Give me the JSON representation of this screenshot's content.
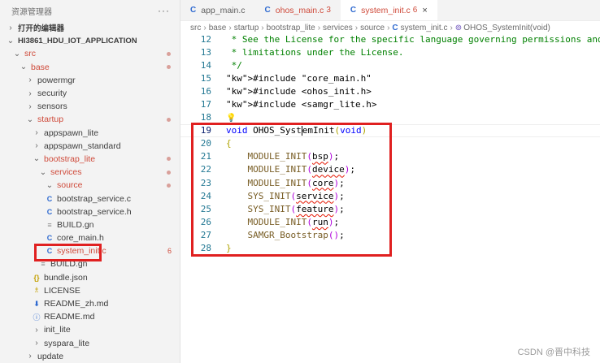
{
  "explorer": {
    "title": "资源管理器",
    "more_icon": "···",
    "items": [
      {
        "label": "打开的编辑器",
        "indent": 0,
        "arrow": "›",
        "style": "bold"
      },
      {
        "label": "HI3861_HDU_IOT_APPLICATION",
        "indent": 0,
        "arrow": "⌄",
        "style": "bold"
      },
      {
        "label": "src",
        "indent": 1,
        "arrow": "⌄",
        "style": "red",
        "dot": true
      },
      {
        "label": "base",
        "indent": 2,
        "arrow": "⌄",
        "style": "red",
        "dot": true
      },
      {
        "label": "powermgr",
        "indent": 3,
        "arrow": "›"
      },
      {
        "label": "security",
        "indent": 3,
        "arrow": "›"
      },
      {
        "label": "sensors",
        "indent": 3,
        "arrow": "›"
      },
      {
        "label": "startup",
        "indent": 3,
        "arrow": "⌄",
        "style": "red",
        "dot": true
      },
      {
        "label": "appspawn_lite",
        "indent": 4,
        "arrow": "›"
      },
      {
        "label": "appspawn_standard",
        "indent": 4,
        "arrow": "›"
      },
      {
        "label": "bootstrap_lite",
        "indent": 4,
        "arrow": "⌄",
        "style": "red",
        "dot": true
      },
      {
        "label": "services",
        "indent": 5,
        "arrow": "⌄",
        "style": "red",
        "dot": true
      },
      {
        "label": "source",
        "indent": 6,
        "arrow": "⌄",
        "style": "red",
        "dot": true
      },
      {
        "label": "bootstrap_service.c",
        "indent": 6,
        "icon": "C",
        "icon_class": "c-icon"
      },
      {
        "label": "bootstrap_service.h",
        "indent": 6,
        "icon": "C",
        "icon_class": "c-icon"
      },
      {
        "label": "BUILD.gn",
        "indent": 6,
        "icon": "≡",
        "icon_class": "gn-icon"
      },
      {
        "label": "core_main.h",
        "indent": 6,
        "icon": "C",
        "icon_class": "c-icon"
      },
      {
        "label": "system_init.c",
        "indent": 6,
        "icon": "C",
        "icon_class": "c-icon",
        "style": "red",
        "badge": "6"
      },
      {
        "label": "BUILD.gn",
        "indent": 5,
        "icon": "≡",
        "icon_class": "gn-icon"
      },
      {
        "label": "bundle.json",
        "indent": 4,
        "icon": "{}",
        "icon_class": "json-icon"
      },
      {
        "label": "LICENSE",
        "indent": 4,
        "icon": "♗",
        "icon_class": "lic-icon"
      },
      {
        "label": "README_zh.md",
        "indent": 4,
        "icon": "⬇",
        "icon_class": "md-icon"
      },
      {
        "label": "README.md",
        "indent": 4,
        "icon": "ⓘ",
        "icon_class": "info-icon"
      },
      {
        "label": "init_lite",
        "indent": 4,
        "arrow": "›"
      },
      {
        "label": "syspara_lite",
        "indent": 4,
        "arrow": "›"
      },
      {
        "label": "update",
        "indent": 3,
        "arrow": "›"
      }
    ]
  },
  "tabs": [
    {
      "label": "app_main.c",
      "icon": "C",
      "active": false
    },
    {
      "label": "ohos_main.c",
      "badge": "3",
      "icon": "C",
      "active": false,
      "modified": true
    },
    {
      "label": "system_init.c",
      "badge": "6",
      "icon": "C",
      "active": true,
      "modified": true,
      "close": "×"
    }
  ],
  "breadcrumb": [
    "src",
    "base",
    "startup",
    "bootstrap_lite",
    "services",
    "source",
    "system_init.c",
    "OHOS_SystemInit(void)"
  ],
  "breadcrumb_file_icon": "C",
  "breadcrumb_symbol_icon": "⊚",
  "code": {
    "lines": [
      {
        "n": "12",
        "text": " * See the License for the specific language governing permissions and"
      },
      {
        "n": "13",
        "text": " * limitations under the License."
      },
      {
        "n": "14",
        "text": " */"
      },
      {
        "n": "15",
        "text": "#include \"core_main.h\""
      },
      {
        "n": "16",
        "text": "#include <ohos_init.h>"
      },
      {
        "n": "17",
        "text": "#include <samgr_lite.h>"
      },
      {
        "n": "18",
        "text": ""
      },
      {
        "n": "19",
        "text": "void OHOS_SystemInit(void)"
      },
      {
        "n": "20",
        "text": "{"
      },
      {
        "n": "21",
        "text": "    MODULE_INIT(bsp);"
      },
      {
        "n": "22",
        "text": "    MODULE_INIT(device);"
      },
      {
        "n": "23",
        "text": "    MODULE_INIT(core);"
      },
      {
        "n": "24",
        "text": "    SYS_INIT(service);"
      },
      {
        "n": "25",
        "text": "    SYS_INIT(feature);"
      },
      {
        "n": "26",
        "text": "    MODULE_INIT(run);"
      },
      {
        "n": "27",
        "text": "    SAMGR_Bootstrap();"
      },
      {
        "n": "28",
        "text": "}"
      }
    ]
  },
  "watermark": "CSDN @晋中科技",
  "colors": {
    "highlight_box": "#e02020",
    "modified": "#cf4a3a",
    "link_blue": "#2f6ad0"
  }
}
